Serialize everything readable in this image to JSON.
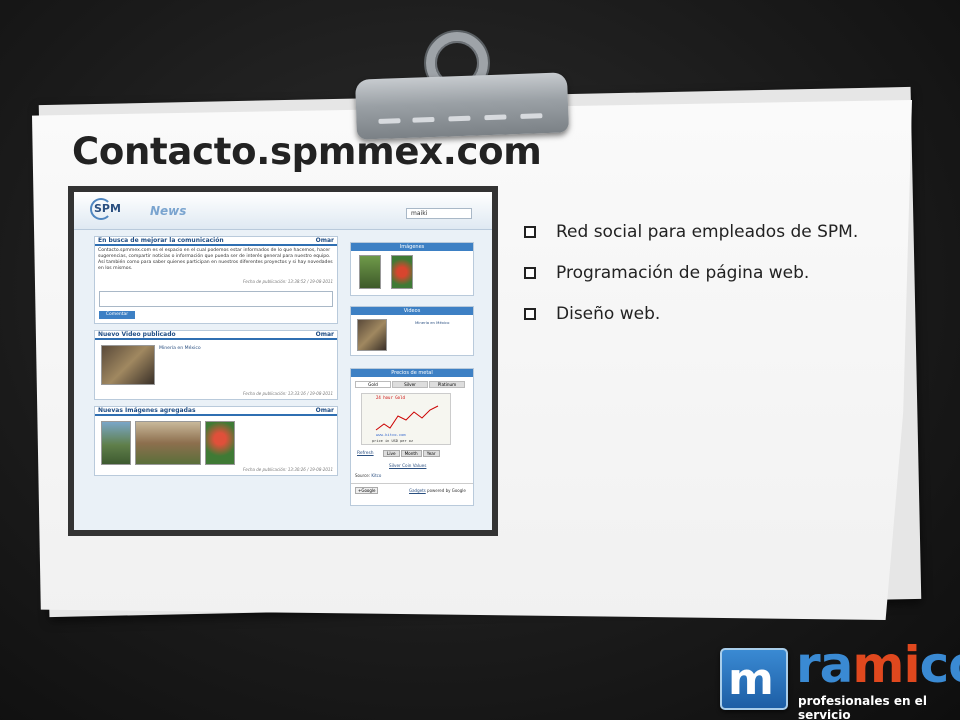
{
  "slide": {
    "title": "Contacto.spmmex.com",
    "bullets": [
      "Red social para empleados de SPM.",
      "Programación de página web.",
      "Diseño web."
    ]
  },
  "screenshot": {
    "logo": "SPM",
    "section": "News",
    "search_value": "maiki",
    "posts": [
      {
        "title": "En busca de mejorar la comunicación",
        "author": "Omar",
        "body": "Contacto.spmmex.com es el espacio en el cual podemos estar informados de lo que hacemos, hacer sugerencias, compartir noticias o información que pueda ser de interés general para nuestro equipo. Así también como para saber quienes participan en nuestros diferentes proyectos y si hay novedades en los mismos.",
        "date": "Fecha de publicación: 13:38:52 / 19-08-2011",
        "button": "Comentar"
      },
      {
        "title": "Nuevo Video publicado",
        "author": "Omar",
        "caption": "Minería en México",
        "date": "Fecha de publicación: 13:33:16 / 19-08-2011"
      },
      {
        "title": "Nuevas Imágenes agregadas",
        "author": "Omar",
        "date": "Fecha de publicación: 13:30:26 / 19-08-2011"
      }
    ],
    "sidebar": {
      "images_title": "Imágenes",
      "videos_title": "Videos",
      "video_caption": "Minería en México",
      "metals_title": "Precios de metal",
      "metal_tabs": [
        "Gold",
        "Silver",
        "Platinum"
      ],
      "chart_title": "24 hour Gold",
      "chart_source": "www.kitco.com",
      "chart_unit": "price in USD per oz",
      "refresh": "Refresh",
      "ranges": [
        "Live",
        "Month",
        "Year"
      ],
      "coin_link": "Silver Coin Values",
      "source_label": "Source:",
      "source_name": "Kitco",
      "gadgets_link": "Gadgets",
      "powered": "powered by Google",
      "google_btn": "+Google"
    }
  },
  "brand": {
    "mark": "m",
    "word_a": "ra",
    "word_b": "mi",
    "word_c": "co",
    "tagline": "profesionales en el servicio"
  }
}
